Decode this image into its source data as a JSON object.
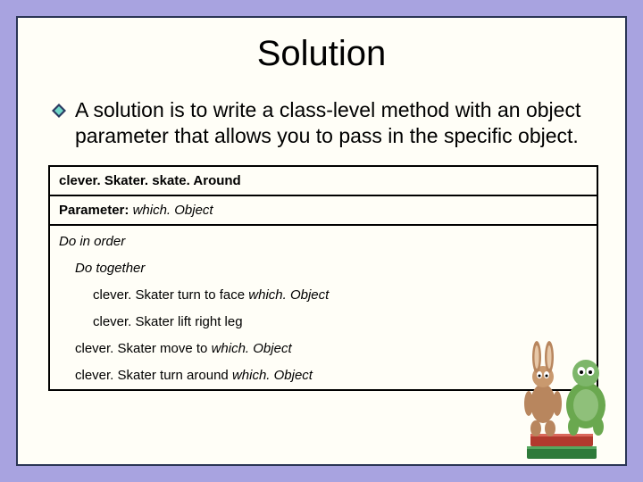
{
  "slide": {
    "title": "Solution",
    "body": " A solution is to write a class-level method with an object parameter that allows you to pass in the specific object."
  },
  "code": {
    "method_name": "clever. Skater. skate. Around",
    "param_label": "Parameter:",
    "param_value": "which. Object",
    "l1": "Do in order",
    "l2": "Do together",
    "l3a": "clever. Skater turn to face ",
    "l3b": "which. Object",
    "l4": "clever. Skater lift right leg",
    "l5a": "clever. Skater move to ",
    "l5b": "which. Object",
    "l6a": "clever. Skater turn around ",
    "l6b": "which. Object"
  }
}
